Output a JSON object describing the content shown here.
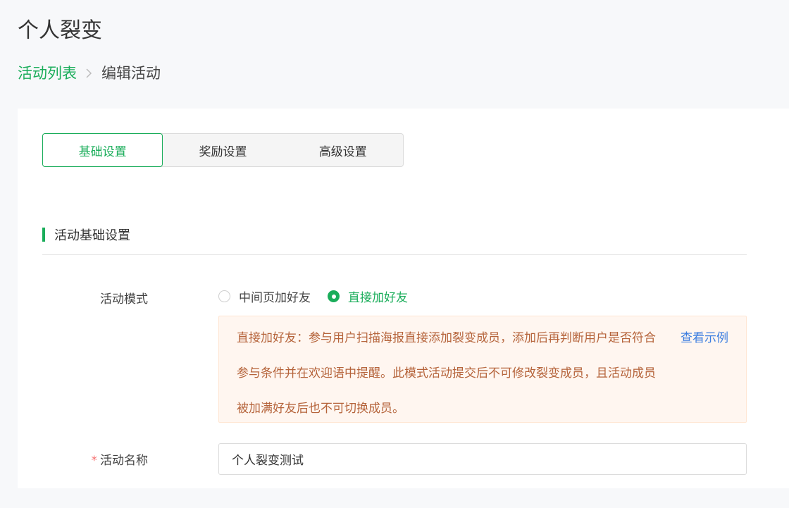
{
  "page": {
    "title": "个人裂变"
  },
  "breadcrumb": {
    "parent": "活动列表",
    "current": "编辑活动"
  },
  "tabs": [
    {
      "label": "基础设置",
      "active": true
    },
    {
      "label": "奖励设置",
      "active": false
    },
    {
      "label": "高级设置",
      "active": false
    }
  ],
  "section": {
    "title": "活动基础设置"
  },
  "form": {
    "mode_label": "活动模式",
    "mode_options": [
      {
        "label": "中间页加好友",
        "checked": false
      },
      {
        "label": "直接加好友",
        "checked": true
      }
    ],
    "notice_text": "直接加好友：参与用户扫描海报直接添加裂变成员，添加后再判断用户是否符合参与条件并在欢迎语中提醒。此模式活动提交后不可修改裂变成员，且活动成员被加满好友后也不可切换成员。",
    "notice_link": "查看示例",
    "name_required_mark": "*",
    "name_label": "活动名称",
    "name_value": "个人裂变测试"
  },
  "colors": {
    "accent": "#1aad5a",
    "notice_bg": "#fff6f0",
    "notice_text": "#b5633a",
    "link": "#3b7de0",
    "required": "#f56c6c"
  },
  "icons": {
    "breadcrumb_separator": "chevron-right-icon"
  }
}
